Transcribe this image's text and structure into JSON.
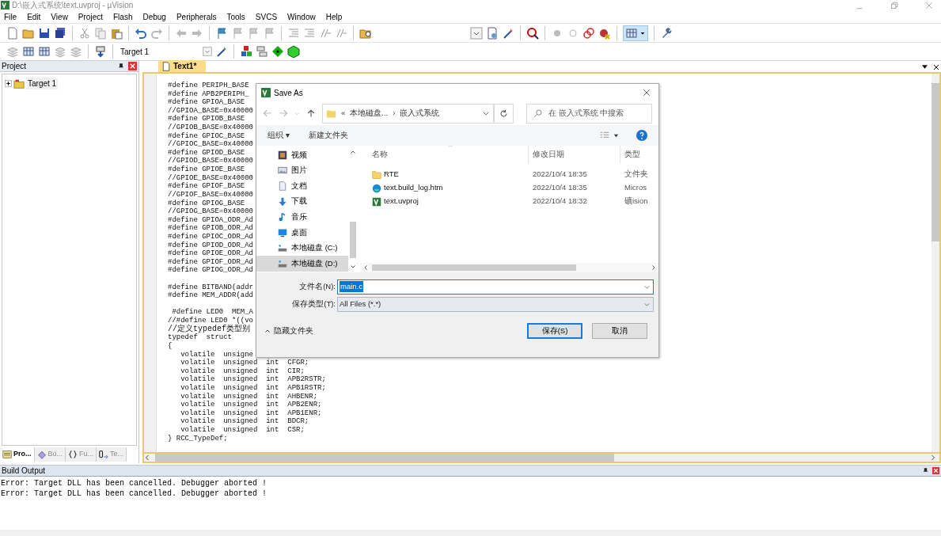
{
  "window": {
    "title": "D:\\嵌入式系统\\text.uvproj - µVision"
  },
  "menu": [
    "File",
    "Edit",
    "View",
    "Project",
    "Flash",
    "Debug",
    "Peripherals",
    "Tools",
    "SVCS",
    "Window",
    "Help"
  ],
  "target_select": {
    "value": "Target 1"
  },
  "project_panel": {
    "title": "Project",
    "tree": [
      {
        "label": "Target 1",
        "expanded": false
      }
    ],
    "tabs": [
      {
        "label": "Pro...",
        "selected": true
      },
      {
        "label": "Bo...",
        "selected": false
      },
      {
        "label": "Fu...",
        "selected": false
      },
      {
        "label": "Te...",
        "selected": false
      }
    ]
  },
  "editor": {
    "tabs": [
      {
        "label": "Text1*",
        "selected": true
      }
    ],
    "blocks": [
      [
        "#define PERIPH_BASE",
        "#define APB2PERIPH_",
        "#define GPIOA_BASE",
        "//GPIOA_BASE=0x40000",
        "#define GPIOB_BASE",
        "//GPIOB_BASE=0x40000",
        "#define GPIOC_BASE",
        "//GPIOC_BASE=0x40000",
        "#define GPIOD_BASE",
        "//GPIOD_BASE=0x40000",
        "#define GPIOE_BASE",
        "//GPIOE_BASE=0x40000",
        "#define GPIOF_BASE",
        "//GPIOF_BASE=0x40000",
        "#define GPIOG_BASE",
        "//GPIOG_BASE=0x40000",
        "#define GPIOA_ODR_Ad",
        "#define GPIOB_ODR_Ad",
        "#define GPIOC_ODR_Ad",
        "#define GPIOD_ODR_Ad",
        "#define GPIOE_ODR_Ad",
        "#define GPIOF_ODR_Ad",
        "#define GPIOG_ODR_Ad"
      ],
      [
        "#define BITBAND(addr",
        "#define MEM_ADDR(add"
      ],
      [
        " #define LED0  MEM_A",
        "//#define LED0 *((vo",
        "//定义typedef类型别",
        "typedef  struct",
        "{",
        "   volatile  unsigne",
        "   volatile  unsigned  int  CFGR;",
        "   volatile  unsigned  int  CIR;",
        "   volatile  unsigned  int  APB2RSTR;",
        "   volatile  unsigned  int  APB1RSTR;",
        "   volatile  unsigned  int  AHBENR;",
        "   volatile  unsigned  int  APB2ENR;",
        "   volatile  unsigned  int  APB1ENR;",
        "   volatile  unsigned  int  BDCR;",
        "   volatile  unsigned  int  CSR;",
        "} RCC_TypeDef;"
      ]
    ]
  },
  "build_output": {
    "title": "Build Output",
    "lines": [
      "Error: Target DLL has been cancelled. Debugger aborted !",
      "Error: Target DLL has been cancelled. Debugger aborted !"
    ]
  },
  "dialog": {
    "title": "Save As",
    "breadcrumb": [
      "«",
      "本地磁盘...",
      "›",
      "嵌入式系统"
    ],
    "search": {
      "placeholder": "在 嵌入式系统 中搜索"
    },
    "toolbar": [
      "组织 ▾",
      "新建文件夹"
    ],
    "nav": [
      {
        "label": "视频",
        "kind": "video",
        "selected": false
      },
      {
        "label": "图片",
        "kind": "pictures",
        "selected": false
      },
      {
        "label": "文档",
        "kind": "documents",
        "selected": false
      },
      {
        "label": "下载",
        "kind": "downloads",
        "selected": false
      },
      {
        "label": "音乐",
        "kind": "music",
        "selected": false
      },
      {
        "label": "桌面",
        "kind": "desktop",
        "selected": false
      },
      {
        "label": "本地磁盘 (C:)",
        "kind": "drive",
        "selected": false
      },
      {
        "label": "本地磁盘 (D:)",
        "kind": "drive",
        "selected": true
      }
    ],
    "columns": [
      "名称",
      "修改日期",
      "类型"
    ],
    "files": [
      {
        "name": "RTE",
        "date": "2022/10/4 18:35",
        "type": "文件夹",
        "kind": "folder"
      },
      {
        "name": "text.build_log.htm",
        "date": "2022/10/4 18:35",
        "type": "Micros",
        "kind": "browser"
      },
      {
        "name": "text.uvproj",
        "date": "2022/10/4 18:32",
        "type": "礦ision",
        "kind": "project"
      }
    ],
    "filename": {
      "label": "文件名(N):",
      "value": "main.c"
    },
    "filetype": {
      "label": "保存类型(T):",
      "value": "All Files (*.*)"
    },
    "hide_folders": "隐藏文件夹",
    "buttons": [
      "保存(S)",
      "取消"
    ]
  }
}
